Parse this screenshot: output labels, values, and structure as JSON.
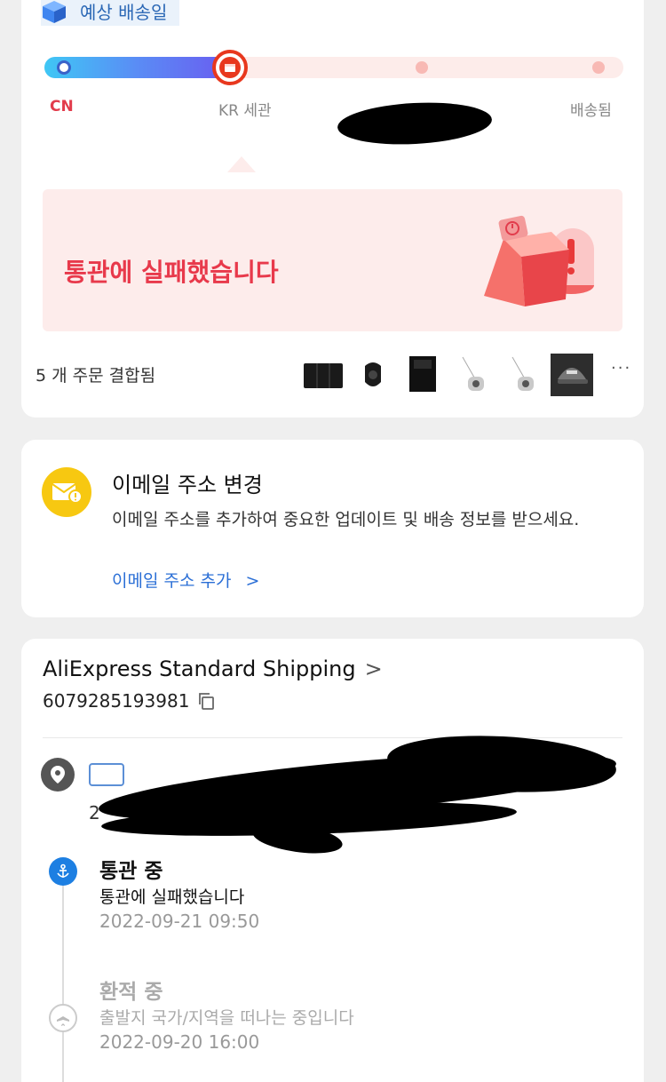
{
  "delivery": {
    "eta_label": "예상 배송일",
    "progress": 0.32,
    "stages": [
      "CN",
      "KR 세관",
      "",
      "배송됨"
    ],
    "status_message": "통관에 실패했습니다",
    "combined_orders": "5 개 주문 결합됨",
    "more": "···",
    "colors": {
      "progress_start": "#3fc7f5",
      "progress_end": "#6a5cf0",
      "alert": "#e8394b",
      "track_bg": "#fdecea"
    }
  },
  "email_prompt": {
    "title": "이메일 주소 변경",
    "description": "이메일 주소를 추가하여 중요한 업데이트 및 배송 정보를 받으세요.",
    "link": "이메일 주소 추가",
    "link_chevron": ">",
    "icon": "mail-icon"
  },
  "shipping": {
    "carrier": "AliExpress Standard Shipping",
    "carrier_chevron": ">",
    "tracking_number": "6079285193981",
    "address_fragment": "2",
    "events": [
      {
        "title": "통관 중",
        "description": "통관에 실패했습니다",
        "time": "2022-09-21 09:50",
        "icon": "anchor-icon",
        "active": true
      },
      {
        "title": "환적 중",
        "description": "출발지 국가/지역을 떠나는 중입니다",
        "time": "2022-09-20 16:00",
        "icon": "plane-icon",
        "active": false
      }
    ]
  }
}
